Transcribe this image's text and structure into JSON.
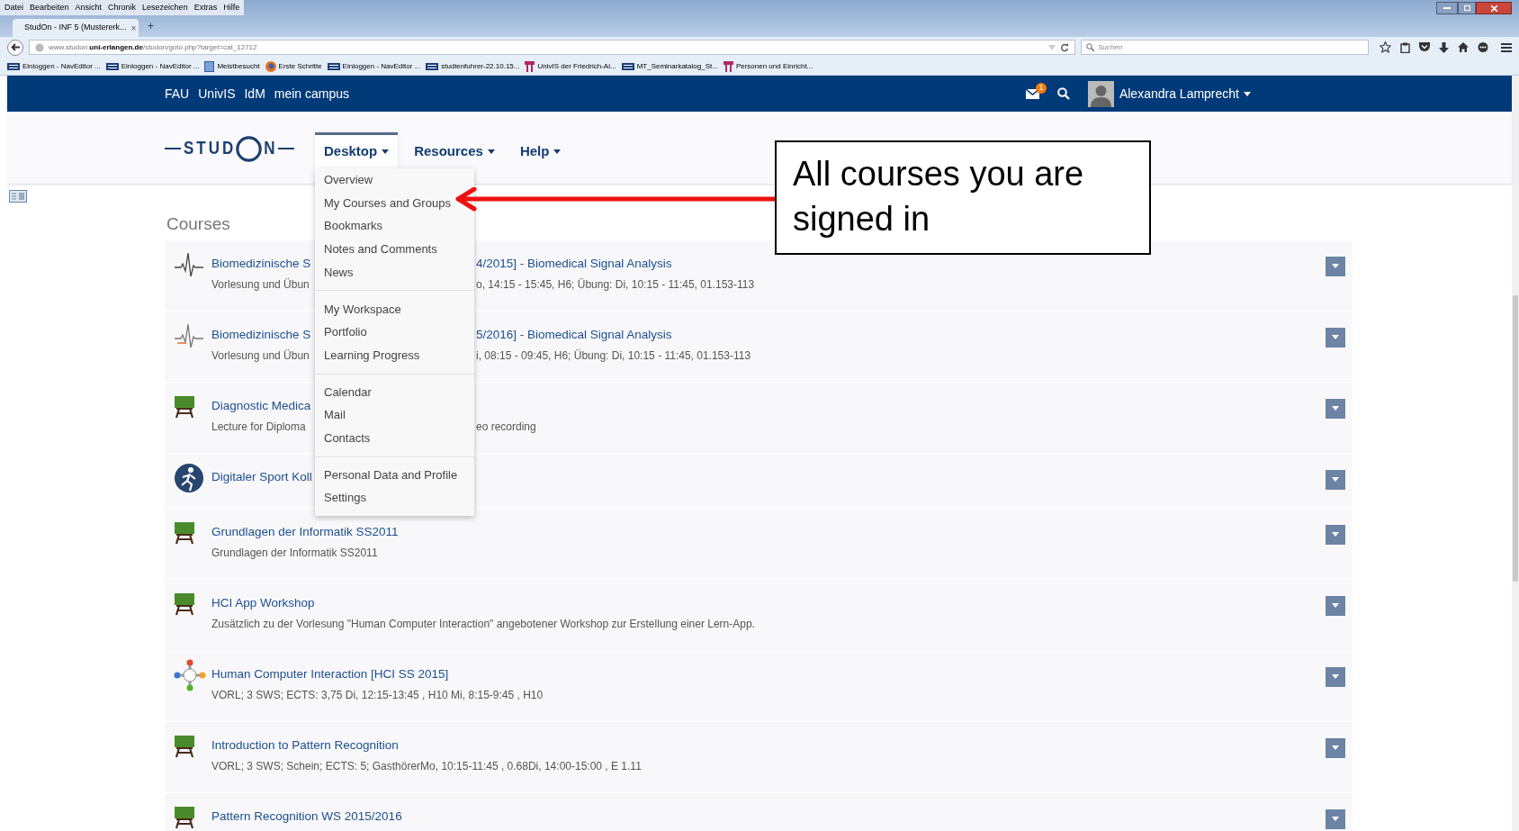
{
  "browser": {
    "menu": [
      "Datei",
      "Bearbeiten",
      "Ansicht",
      "Chronik",
      "Lesezeichen",
      "Extras",
      "Hilfe"
    ],
    "tab": {
      "title": "StudOn - INF 5 (Mustererk...",
      "close": "×",
      "new_tab": "+"
    },
    "url": "www.studon.**uni-erlangen.de**/studon/goto.php?target=cat_12712",
    "search": {
      "placeholder": "Suchen"
    },
    "bookmarks": [
      {
        "label": "Einloggen - NavEditor ...",
        "kind": "fau"
      },
      {
        "label": "Einloggen - NavEditor ...",
        "kind": "fau"
      },
      {
        "label": "Meistbesucht",
        "kind": "folder"
      },
      {
        "label": "Erste Schritte",
        "kind": "firefox"
      },
      {
        "label": "Einloggen - NavEditor ...",
        "kind": "fau"
      },
      {
        "label": "studienfuhrer-22.10.15...",
        "kind": "fau"
      },
      {
        "label": "UnivIS der Friedrich-Al...",
        "kind": "univis"
      },
      {
        "label": "MT_Seminarkatalog_St...",
        "kind": "fau"
      },
      {
        "label": "Personen und Einricht...",
        "kind": "univis"
      }
    ]
  },
  "topbar": {
    "links": [
      "FAU",
      "UnivIS",
      "IdM",
      "mein campus"
    ],
    "mail_badge": "1",
    "user": "Alexandra Lamprecht"
  },
  "nav": [
    {
      "label": "Desktop",
      "selected": true
    },
    {
      "label": "Resources",
      "selected": false
    },
    {
      "label": "Help",
      "selected": false
    }
  ],
  "desktop_menu": [
    [
      "Overview",
      "My Courses and Groups",
      "Bookmarks",
      "Notes and Comments",
      "News"
    ],
    [
      "My Workspace",
      "Portfolio",
      "Learning Progress"
    ],
    [
      "Calendar",
      "Mail",
      "Contacts"
    ],
    [
      "Personal Data and Profile",
      "Settings"
    ]
  ],
  "logo": {
    "left": "STUD",
    "right": "N"
  },
  "section_title": "Courses",
  "courses": [
    {
      "kind": "ecg",
      "title": "Biomedizinische S",
      "title_rest": "4/2015] - Biomedical Signal Analysis",
      "description": "Vorlesung und Übun",
      "description_rest": "o, 14:15 - 15:45, H6; Übung: Di, 10:15 - 11:45, 01.153-113"
    },
    {
      "kind": "ecg2",
      "title": "Biomedizinische S",
      "title_rest": "5/2016] - Biomedical Signal Analysis",
      "description": "Vorlesung und Übun",
      "description_rest": "i, 08:15 - 09:45, H6; Übung: Di, 10:15 - 11:45, 01.153-113"
    },
    {
      "kind": "board",
      "title": "Diagnostic Medica",
      "description": "Lecture for Diploma",
      "description_rest": "eo recording"
    },
    {
      "kind": "sport",
      "title": "Digitaler Sport Koll"
    },
    {
      "kind": "board",
      "title": "Grundlagen der Informatik SS2011",
      "description": "Grundlagen der Informatik SS2011"
    },
    {
      "kind": "board",
      "title": "HCI App Workshop",
      "description": "Zusätzlich zu der Vorlesung \"Human Computer Interaction\" angebotener Workshop zur Erstellung einer Lern-App."
    },
    {
      "kind": "hci",
      "title": "Human Computer Interaction [HCI SS 2015]",
      "description": "VORL; 3 SWS; ECTS: 3,75 Di, 12:15-13:45 , H10 Mi, 8:15-9:45 , H10"
    },
    {
      "kind": "board",
      "title": "Introduction to Pattern Recognition",
      "description": "VORL; 3 SWS; Schein; ECTS: 5; GasthörerMo, 10:15-11:45 , 0.68Di, 14:00-15:00 , E 1.11"
    },
    {
      "kind": "board",
      "title": "Pattern Recognition WS 2015/2016"
    }
  ],
  "annotation": "All courses you are signed in"
}
